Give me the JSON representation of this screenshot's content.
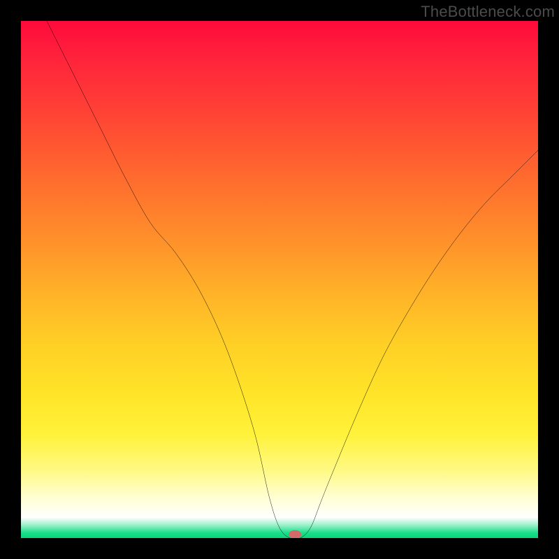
{
  "watermark": "TheBottleneck.com",
  "colors": {
    "frame_bg": "#000000",
    "curve_stroke": "#000000",
    "marker_fill": "#d36a6a",
    "marker_stroke": "#b55858",
    "gradient_stops": [
      {
        "offset": 0.0,
        "hex": "#ff0a3a"
      },
      {
        "offset": 0.18,
        "hex": "#ff4335"
      },
      {
        "offset": 0.42,
        "hex": "#ff8f2b"
      },
      {
        "offset": 0.62,
        "hex": "#ffce26"
      },
      {
        "offset": 0.8,
        "hex": "#fff23a"
      },
      {
        "offset": 0.92,
        "hex": "#ffffd1"
      },
      {
        "offset": 0.96,
        "hex": "#ffffff"
      },
      {
        "offset": 0.99,
        "hex": "#17e088"
      }
    ]
  },
  "chart_data": {
    "type": "line",
    "title": "",
    "xlabel": "",
    "ylabel": "",
    "xlim": [
      0,
      100
    ],
    "ylim": [
      0,
      100
    ],
    "x": [
      5,
      10,
      15,
      20,
      25,
      30,
      35,
      40,
      45,
      48,
      50,
      52,
      54,
      56,
      58,
      60,
      65,
      70,
      75,
      80,
      85,
      90,
      95,
      100
    ],
    "y": [
      100,
      90,
      80,
      70,
      61,
      55,
      47,
      36,
      21,
      8,
      2,
      0,
      0,
      2,
      7,
      12,
      24,
      35,
      44,
      52,
      59,
      65,
      70,
      75
    ],
    "marker": {
      "x": 53,
      "y": 0.7,
      "rx": 1.2,
      "ry": 0.8
    },
    "note": "x is horizontal position in % of plot width (0=left, 100=right); y is vertical value in % of plot height above bottom (0=bottom green band, 100=top red). Values estimated from pixels; curve forms a V shape with minimum near x≈53, left branch reaching the top-left corner, right branch ending around y≈75 at the right edge."
  }
}
